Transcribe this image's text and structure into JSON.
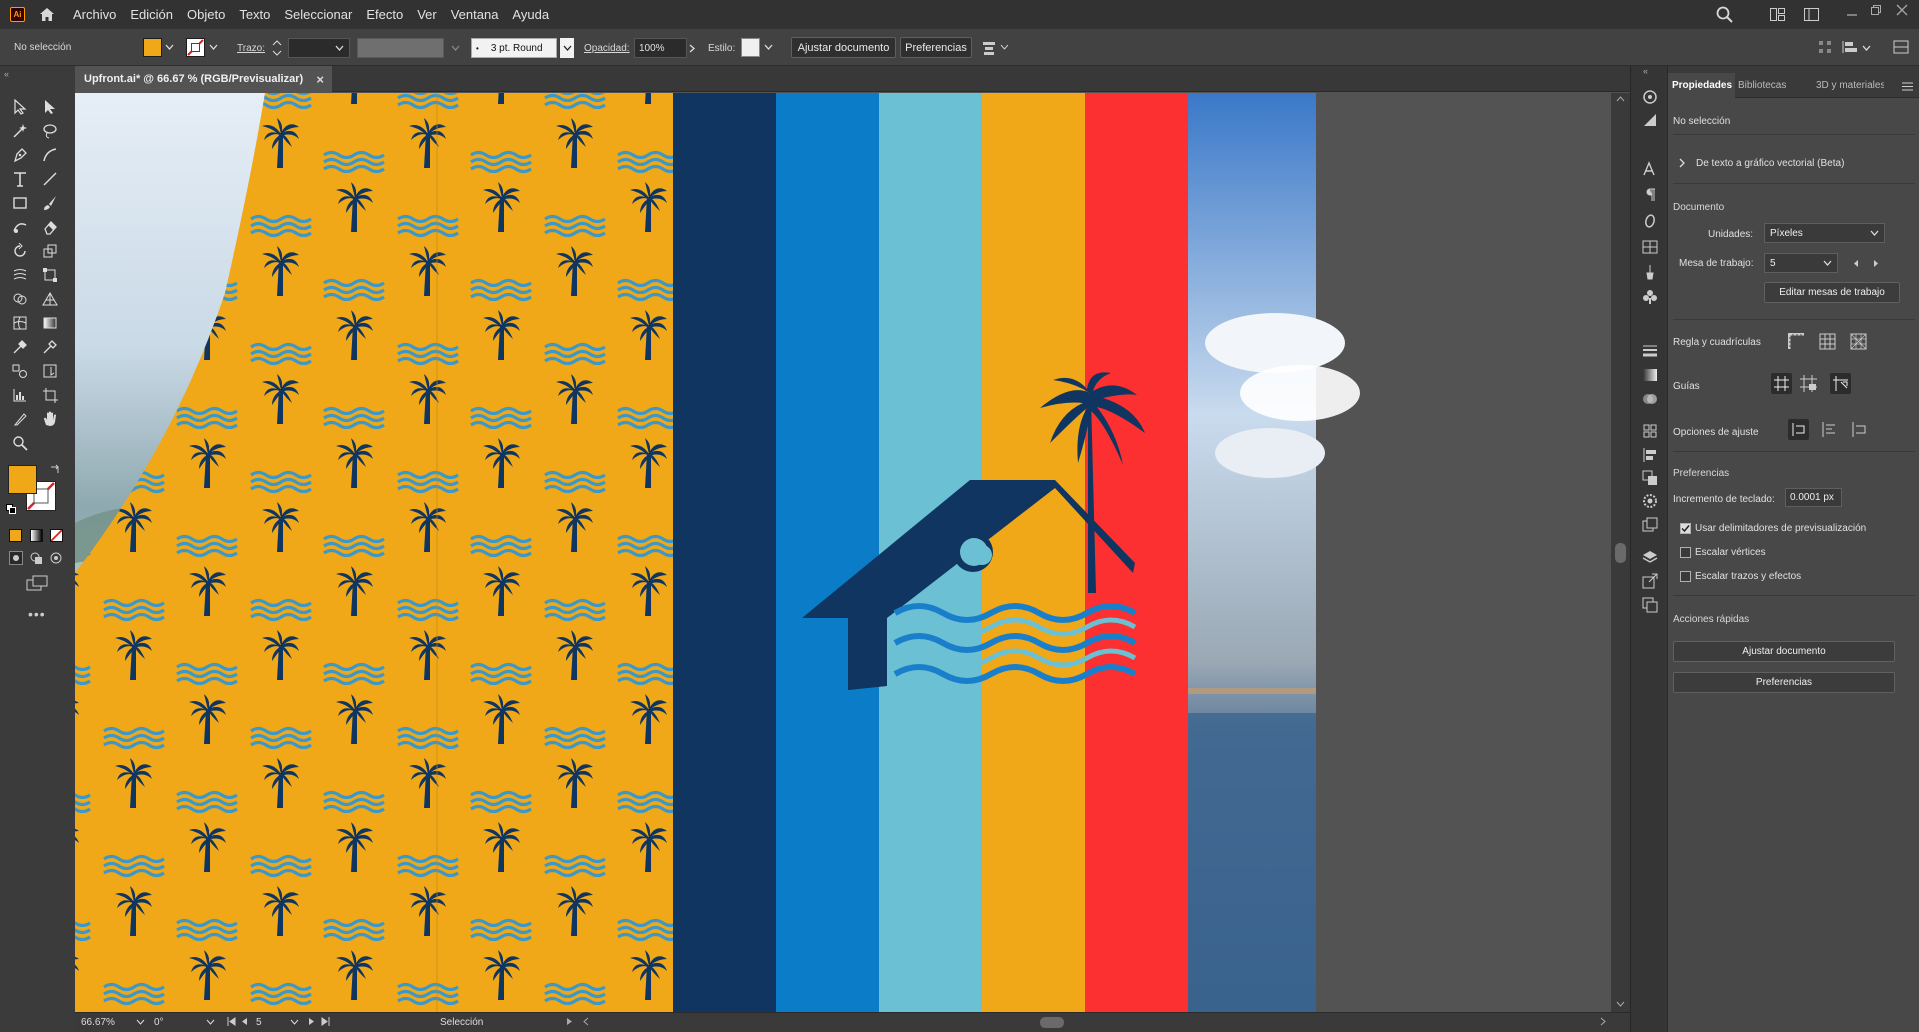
{
  "app": {
    "logo": "Ai",
    "home_icon": "home-icon"
  },
  "menu": [
    "Archivo",
    "Edición",
    "Objeto",
    "Texto",
    "Seleccionar",
    "Efecto",
    "Ver",
    "Ventana",
    "Ayuda"
  ],
  "options": {
    "selection": "No selección",
    "fill_color": "#f0a818",
    "stroke_label": "Trazo:",
    "brush": "3 pt. Round",
    "opacity_label": "Opacidad:",
    "opacity_value": "100%",
    "style_label": "Estilo:",
    "fit_button": "Ajustar documento",
    "prefs_button": "Preferencias"
  },
  "document": {
    "tab_title": "Upfront.ai* @ 66.67 % (RGB/Previsualizar)",
    "close": "×"
  },
  "status": {
    "zoom": "66.67%",
    "rotation": "0°",
    "artboard": "5",
    "tool": "Selección"
  },
  "artwork": {
    "orange": "#f0a818",
    "navy": "#0f3560",
    "stripes": [
      "#0f3560",
      "#0a7cc8",
      "#6cc0d4",
      "#f0a818",
      "#fc3030"
    ],
    "wave_dark": "#1a7fca",
    "wave_light": "#6cc0d4"
  },
  "panel": {
    "tabs": [
      "Propiedades",
      "Bibliotecas",
      "3D y materiales"
    ],
    "no_selection": "No selección",
    "text_to_vector": "De texto a gráfico vectorial (Beta)",
    "document_header": "Documento",
    "units_label": "Unidades:",
    "units_value": "Píxeles",
    "artboard_label": "Mesa de trabajo:",
    "artboard_value": "5",
    "edit_artboards": "Editar mesas de trabajo",
    "rulers_label": "Regla y cuadrículas",
    "guides_label": "Guías",
    "snap_label": "Opciones de ajuste",
    "prefs_header": "Preferencias",
    "keyboard_inc_label": "Incremento de teclado:",
    "keyboard_inc_value": "0.0001 px",
    "cb_preview_bounds": "Usar delimitadores de previsualización",
    "cb_scale_corners": "Escalar vértices",
    "cb_scale_strokes": "Escalar trazos y efectos",
    "quick_actions": "Acciones rápidas",
    "qa_fit": "Ajustar documento",
    "qa_prefs": "Preferencias"
  }
}
